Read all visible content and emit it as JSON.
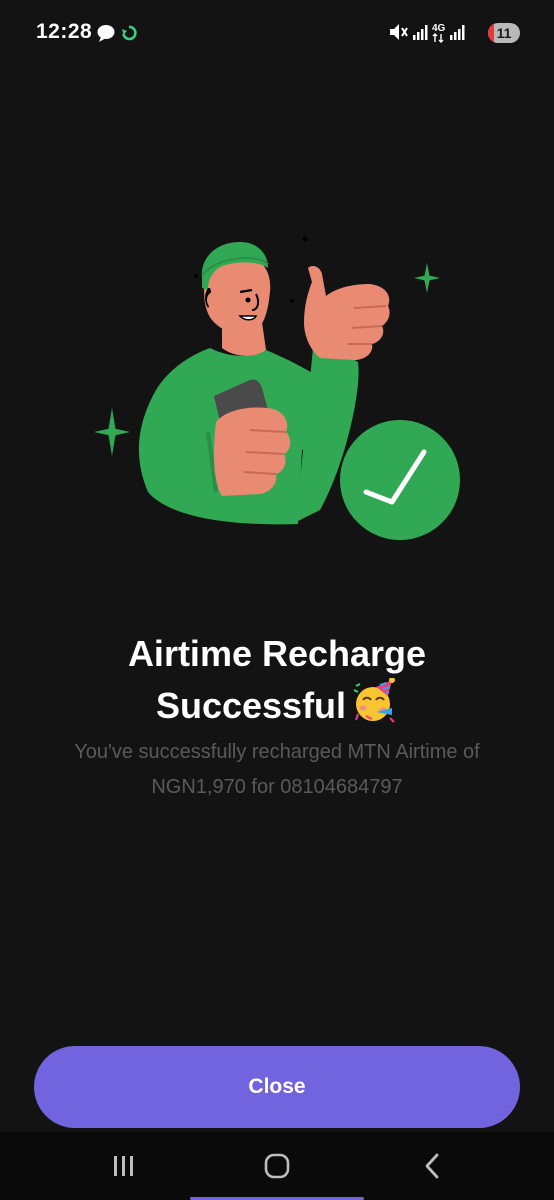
{
  "status_bar": {
    "time": "12:28",
    "battery_level": "11",
    "network_type": "4G",
    "icons": [
      "chat-bubble-icon",
      "sync-icon",
      "mute-icon",
      "signal-icon",
      "network-4g-icon",
      "signal-icon-2",
      "battery-icon"
    ]
  },
  "illustration": {
    "description_icon": "thumbs-up-person-illustration",
    "check_icon": "checkmark-circle-icon"
  },
  "result": {
    "title_line1": "Airtime Recharge",
    "title_line2": "Successful",
    "title_emoji": "party-face-emoji",
    "message_line1": "You've successfully recharged MTN Airtime of",
    "message_line2": "NGN1,970 for 08104684797"
  },
  "actions": {
    "close_label": "Close"
  },
  "nav": {
    "buttons": [
      "recent-apps-icon",
      "home-icon",
      "back-icon"
    ]
  },
  "colors": {
    "background": "#131313",
    "accent_green": "#31a853",
    "button_purple": "#7264df",
    "muted_text": "#5a5a5a"
  }
}
